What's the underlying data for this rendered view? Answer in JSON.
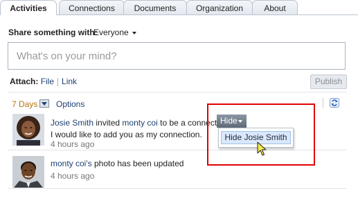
{
  "tabs": [
    {
      "label": "Activities",
      "active": true
    },
    {
      "label": "Connections",
      "active": false
    },
    {
      "label": "Documents",
      "active": false
    },
    {
      "label": "Organization",
      "active": false
    },
    {
      "label": "About",
      "active": false
    }
  ],
  "share": {
    "label": "Share something with:",
    "audience": "Everyone",
    "placeholder": "What's on your mind?"
  },
  "attach": {
    "label": "Attach:",
    "file": "File",
    "link": "Link",
    "publish": "Publish"
  },
  "filter": {
    "days": "7 Days",
    "options": "Options",
    "refresh_icon": "refresh-icon"
  },
  "feed": [
    {
      "actor": "Josie Smith",
      "verb": "invited",
      "target": "monty coi",
      "rest": "to be a connection",
      "message": "I would like to add you as my connection.",
      "time": "4 hours ago"
    },
    {
      "actor": "monty coi's",
      "rest": "photo has been updated",
      "time": "4 hours ago"
    }
  ],
  "hide_button": {
    "label": "Hide",
    "menu_item": "Hide Josie Smith"
  },
  "colors": {
    "link": "#1c3f72",
    "days": "#b8740b",
    "highlight": "#e00000",
    "menu_item_bg": "#dbe8fb"
  }
}
